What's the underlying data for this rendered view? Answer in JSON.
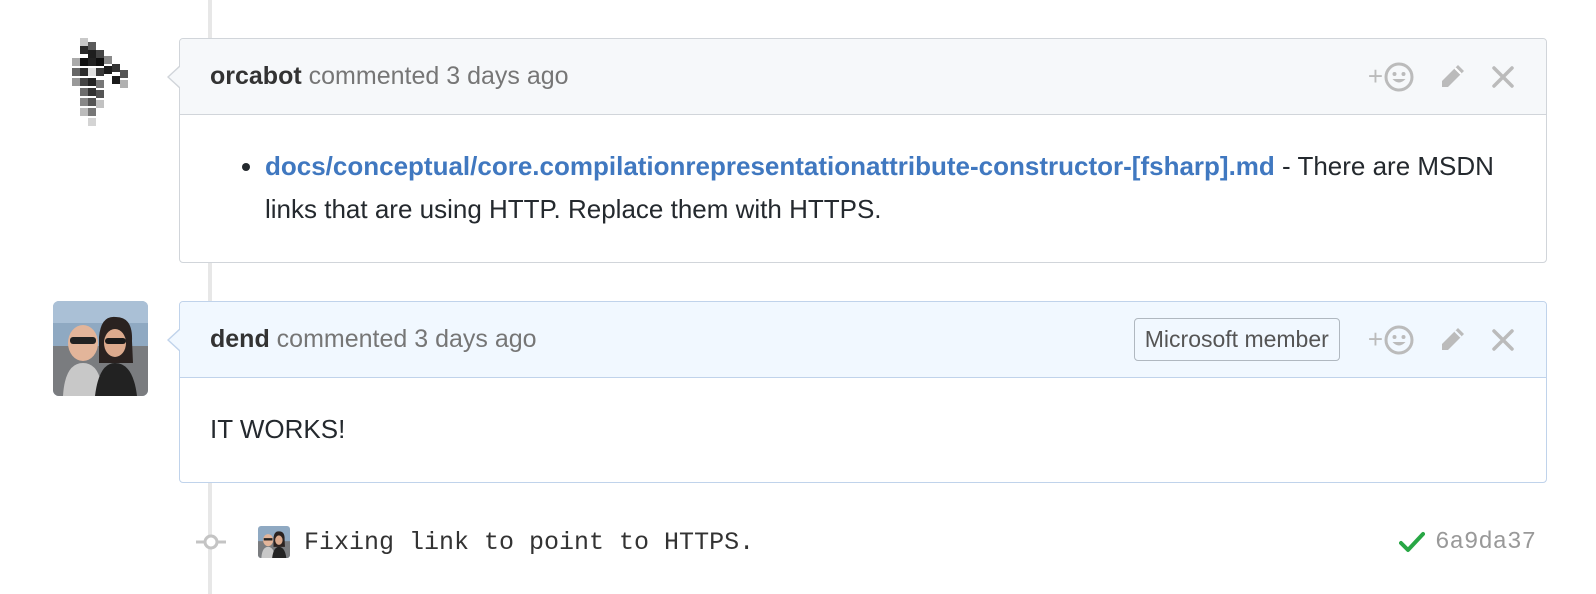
{
  "comments": [
    {
      "author": "orcabot",
      "action": "commented",
      "time": "3 days ago",
      "badge": "",
      "body_link": "docs/conceptual/core.compilationrepresentationattribute-constructor-[fsharp].md",
      "body_text": " - There are MSDN links that are using HTTP. Replace them with HTTPS."
    },
    {
      "author": "dend",
      "action": "commented",
      "time": "3 days ago",
      "badge": "Microsoft member",
      "body_text": "IT WORKS!"
    }
  ],
  "actions": {
    "reaction_plus": "+"
  },
  "commit": {
    "message": "Fixing link to point to HTTPS.",
    "sha": "6a9da37",
    "status": "success"
  },
  "icons": {
    "reaction": "smiley-icon",
    "edit": "pencil-icon",
    "delete": "close-icon",
    "commit_node": "git-commit-icon",
    "status": "check-icon"
  },
  "colors": {
    "link": "#4078c0",
    "member_header_bg": "#f1f8ff",
    "header_bg": "#f6f8fa",
    "success": "#28a745"
  }
}
